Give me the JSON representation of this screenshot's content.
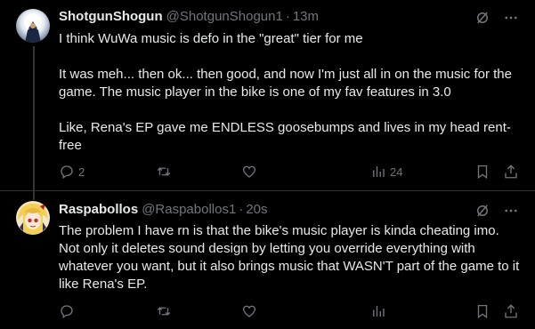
{
  "tweets": [
    {
      "display_name": "ShotgunShogun",
      "handle": "@ShotgunShogun1",
      "separator": "·",
      "time": "13m",
      "paragraphs": [
        "I think WuWa music is defo in the \"great\" tier for me",
        "It was meh... then ok... then good, and now I'm just all in on the music for the game. The music player in the bike is one of my fav features in 3.0",
        "Like, Rena's EP gave me ENDLESS goosebumps and lives in my head rent-free"
      ],
      "replies": "2",
      "reposts": "",
      "likes": "",
      "views": "24"
    },
    {
      "display_name": "Raspabollos",
      "handle": "@Raspabollos1",
      "separator": "·",
      "time": "20s",
      "paragraphs": [
        "The problem I have rn is that the bike's music player is kinda cheating imo. Not only it deletes sound design by letting you override everything with whatever you want, but it also brings music that WASN'T part of the game to it like Rena's EP."
      ],
      "replies": "",
      "reposts": "",
      "likes": "",
      "views": ""
    }
  ],
  "colors": {
    "background": "#000000",
    "text": "#e7e9ea",
    "muted": "#71767b",
    "divider": "#2f3336"
  },
  "icons": [
    "grok-slash-icon",
    "more-icon",
    "reply-icon",
    "repost-icon",
    "like-icon",
    "views-icon",
    "bookmark-icon",
    "share-icon"
  ]
}
